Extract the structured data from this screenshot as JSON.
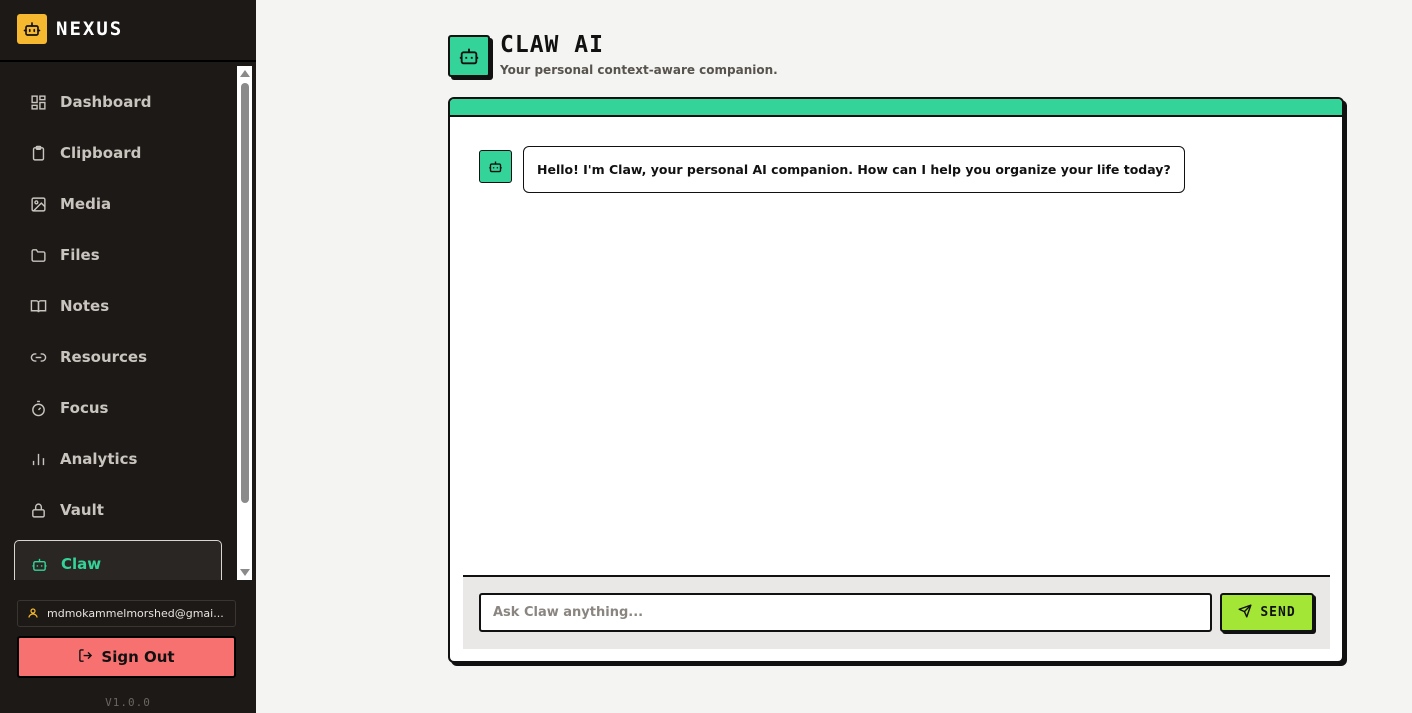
{
  "brand": {
    "name": "NEXUS",
    "icon": "robot-icon",
    "accent": "#f5b82e"
  },
  "sidebar": {
    "items": [
      {
        "label": "Dashboard",
        "icon": "grid-icon"
      },
      {
        "label": "Clipboard",
        "icon": "clipboard-icon"
      },
      {
        "label": "Media",
        "icon": "image-icon"
      },
      {
        "label": "Files",
        "icon": "folder-icon"
      },
      {
        "label": "Notes",
        "icon": "book-icon"
      },
      {
        "label": "Resources",
        "icon": "link-icon"
      },
      {
        "label": "Focus",
        "icon": "timer-icon"
      },
      {
        "label": "Analytics",
        "icon": "bar-chart-icon"
      },
      {
        "label": "Vault",
        "icon": "lock-icon"
      },
      {
        "label": "Claw",
        "icon": "robot-icon",
        "active": true
      }
    ],
    "active_color": "#34d399"
  },
  "user": {
    "email": "mdmokammelmorshed@gmai..."
  },
  "signout": {
    "label": "Sign Out",
    "color": "#f87171"
  },
  "version": "V1.0.0",
  "page": {
    "title": "CLAW AI",
    "subtitle": "Your personal context-aware companion."
  },
  "chat": {
    "messages": [
      {
        "role": "assistant",
        "text": "Hello! I'm Claw, your personal AI companion. How can I help you organize your life today?"
      }
    ],
    "input": {
      "placeholder": "Ask Claw anything...",
      "value": ""
    },
    "send_label": "SEND",
    "send_color": "#a3e635"
  }
}
